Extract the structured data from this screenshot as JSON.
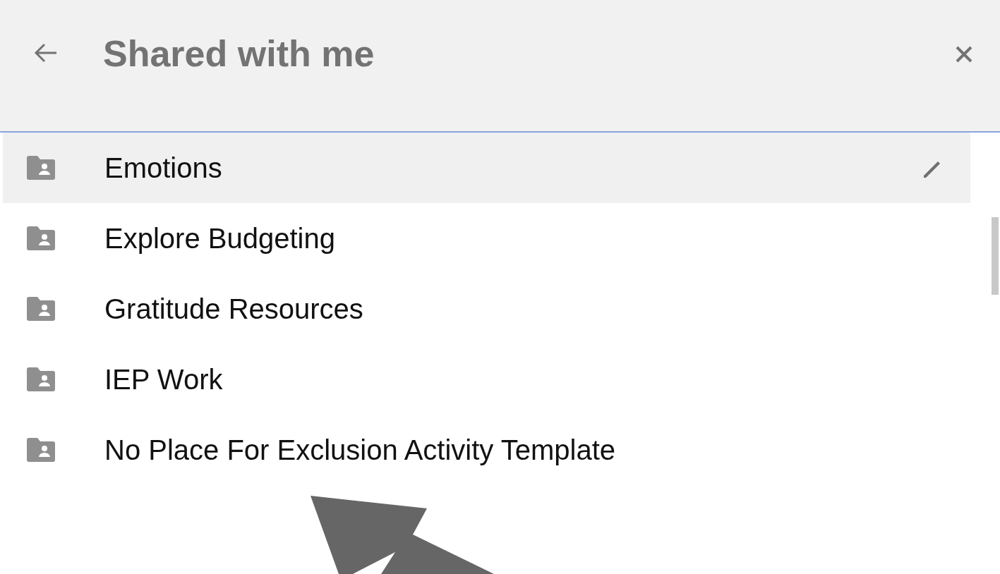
{
  "header": {
    "title": "Shared with me"
  },
  "folders": [
    {
      "name": "Emotions",
      "selected": true
    },
    {
      "name": "Explore Budgeting",
      "selected": false
    },
    {
      "name": "Gratitude Resources",
      "selected": false
    },
    {
      "name": "IEP Work",
      "selected": false
    },
    {
      "name": "No Place For Exclusion Activity Template",
      "selected": false
    }
  ]
}
